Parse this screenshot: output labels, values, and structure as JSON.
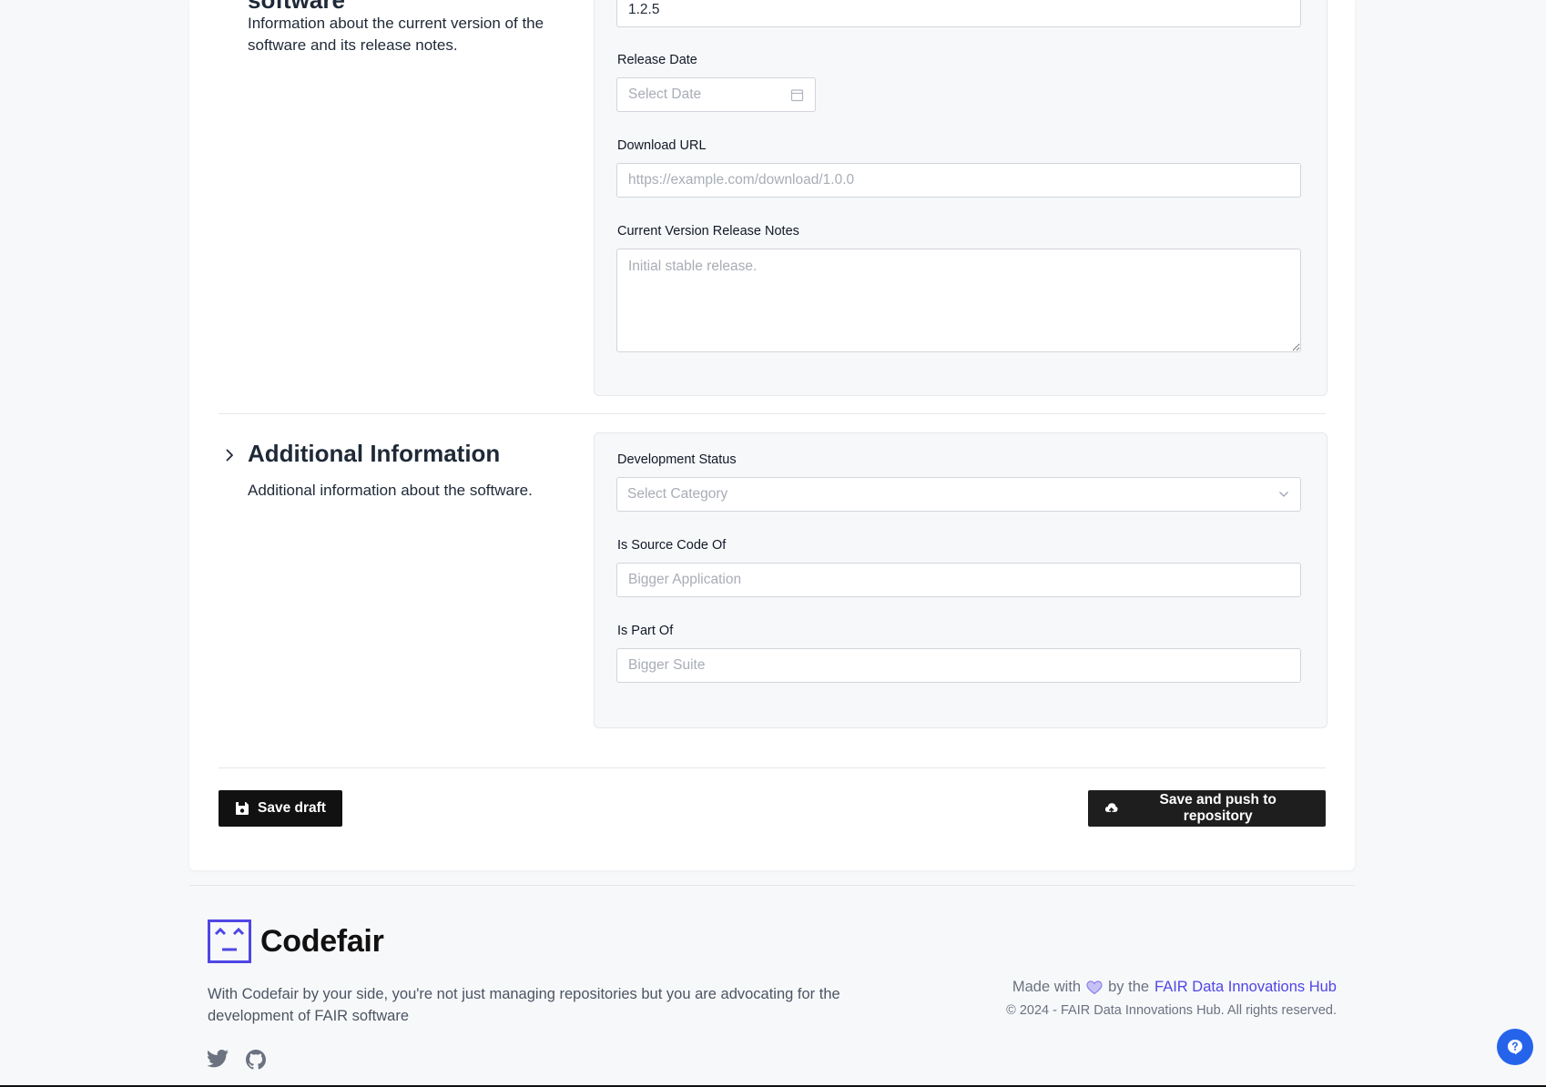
{
  "section_version": {
    "title_partial": "software",
    "description": "Information about the current version of the software and its release notes.",
    "version_value": "1.2.5",
    "release_date_label": "Release Date",
    "release_date_placeholder": "Select Date",
    "download_url_label": "Download URL",
    "download_url_placeholder": "https://example.com/download/1.0.0",
    "release_notes_label": "Current Version Release Notes",
    "release_notes_placeholder": "Initial stable release."
  },
  "section_additional": {
    "title": "Additional Information",
    "description": "Additional information about the software.",
    "dev_status_label": "Development Status",
    "dev_status_placeholder": "Select Category",
    "is_source_code_of_label": "Is Source Code Of",
    "is_source_code_of_placeholder": "Bigger Application",
    "is_part_of_label": "Is Part Of",
    "is_part_of_placeholder": "Bigger Suite"
  },
  "actions": {
    "save_draft": "Save draft",
    "save_push": "Save and push to repository"
  },
  "footer": {
    "brand": "Codefair",
    "tagline": "With Codefair by your side, you're not just managing repositories but you are advocating for the development of FAIR software",
    "made_with": "Made with",
    "by_the": "by the",
    "hub_link": "FAIR Data Innovations Hub",
    "copyright": "© 2024 - FAIR Data Innovations Hub. All rights reserved."
  },
  "icons": {
    "calendar": "calendar-icon",
    "chevron_down": "chevron-down-icon",
    "chevron_right": "chevron-right-icon",
    "save": "save-icon",
    "upload": "cloud-upload-icon",
    "heart": "heart-icon",
    "twitter": "twitter-icon",
    "github": "github-icon",
    "help": "help-icon"
  },
  "colors": {
    "accent": "#4f46e5",
    "button_bg": "#111111",
    "help_button": "#2563eb"
  }
}
